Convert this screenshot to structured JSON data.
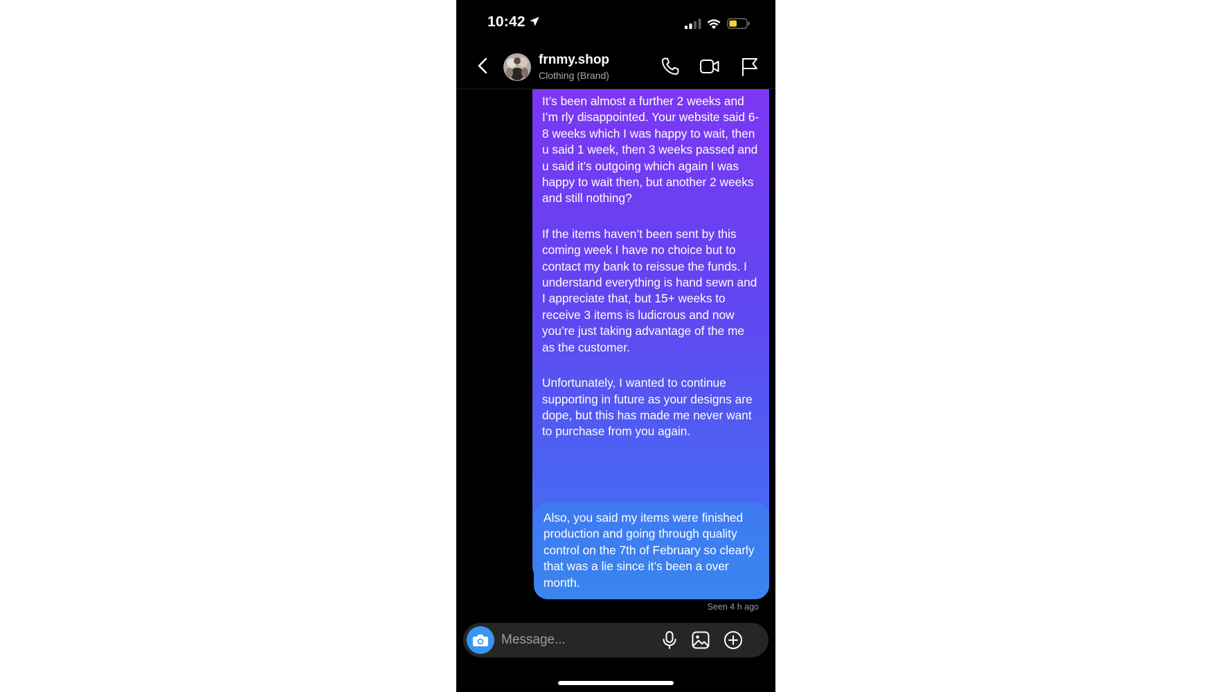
{
  "status_bar": {
    "time": "10:42",
    "location_icon": "location-arrow-icon",
    "signal_icon": "cellular-signal-icon",
    "wifi_icon": "wifi-icon",
    "battery_icon": "battery-icon",
    "battery_color": "#f5d33a"
  },
  "header": {
    "back_icon": "chevron-left-icon",
    "name": "frnmy.shop",
    "subtitle": "Clothing (Brand)",
    "call_icon": "phone-icon",
    "video_icon": "video-camera-icon",
    "report_icon": "flag-icon"
  },
  "messages": [
    {
      "sender": "me",
      "paragraphs": [
        "It’s been almost a further 2 weeks and I’m rly disappointed. Your website said 6-8 weeks which I was happy to wait, then u said 1 week, then 3 weeks passed and u said it’s outgoing which again I was happy to wait then, but another 2 weeks and still nothing?",
        "If the items haven’t been sent by this coming week I have no choice but to contact my bank to reissue the funds. I understand everything is hand sewn and I appreciate that, but 15+ weeks to receive 3 items is ludicrous and now you’re just taking advantage of the me as the customer.",
        "Unfortunately, I wanted to continue supporting in future as your designs are dope, but this has made me never want to purchase from you again."
      ]
    },
    {
      "sender": "me",
      "paragraphs": [
        "Also, you said my items were finished production and going through quality control on the 7th of February so clearly that was a lie since it’s been a over month."
      ]
    }
  ],
  "seen_status": "Seen 4 h ago",
  "composer": {
    "camera_icon": "camera-icon",
    "placeholder": "Message...",
    "mic_icon": "microphone-icon",
    "gallery_icon": "image-gallery-icon",
    "add_icon": "plus-circle-icon"
  },
  "colors": {
    "background": "#000000",
    "bubble_gradient_top": "#7e36f2",
    "bubble_gradient_bottom": "#3b85ee",
    "camera_button": "#3797f0",
    "composer_bg": "#262626"
  }
}
